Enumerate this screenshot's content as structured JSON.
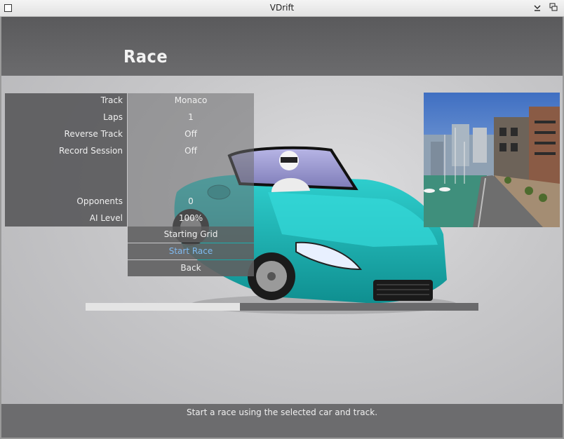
{
  "window": {
    "title": "VDrift"
  },
  "page": {
    "title": "Race"
  },
  "settings": [
    {
      "label": "Track",
      "value": "Monaco"
    },
    {
      "label": "Laps",
      "value": "1"
    },
    {
      "label": "Reverse Track",
      "value": "Off"
    },
    {
      "label": "Record Session",
      "value": "Off"
    },
    {
      "label": "",
      "value": ""
    },
    {
      "label": "",
      "value": ""
    },
    {
      "label": "Opponents",
      "value": "0"
    },
    {
      "label": "AI Level",
      "value": "100%"
    }
  ],
  "menu": {
    "starting_grid": "Starting Grid",
    "start_race": "Start Race",
    "back": "Back"
  },
  "progress": {
    "fraction": 0.393
  },
  "status": "Start a race using the selected car and track.",
  "colors": {
    "accent": "#7fb9f0",
    "car": "#1ab3b3"
  }
}
